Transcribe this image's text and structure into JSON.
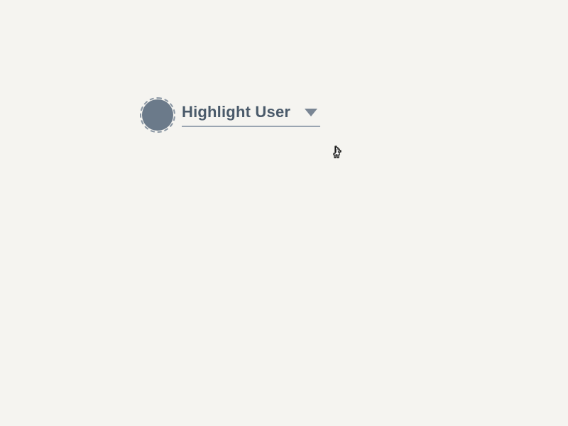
{
  "dropdown": {
    "label": "Highlight User"
  }
}
